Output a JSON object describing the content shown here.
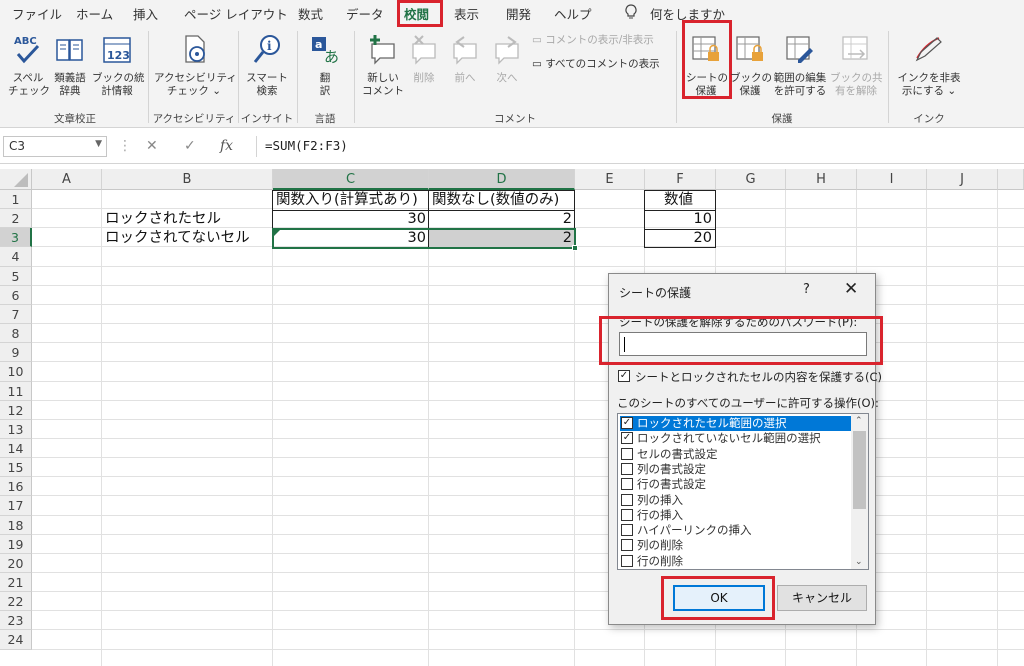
{
  "tabs": [
    "ファイル",
    "ホーム",
    "挿入",
    "ページ レイアウト",
    "数式",
    "データ",
    "校閲",
    "表示",
    "開発",
    "ヘルプ"
  ],
  "tell_me": "何をしますか",
  "ribbon": {
    "buttons": {
      "spelling": [
        "スペル",
        "チェック"
      ],
      "thesaurus": [
        "類義語",
        "辞典"
      ],
      "workbook_stats": [
        "ブックの統",
        "計情報"
      ],
      "accessibility": [
        "アクセシビリティ",
        "チェック ⌄"
      ],
      "smart_lookup": [
        "スマート",
        "検索"
      ],
      "translate": [
        "翻",
        "訳"
      ],
      "new_comment": [
        "新しい",
        "コメント"
      ],
      "delete": "削除",
      "previous": "前へ",
      "next": "次へ",
      "show_hide_comment": "コメントの表示/非表示",
      "show_all_comments": "すべてのコメントの表示",
      "protect_sheet": [
        "シートの",
        "保護"
      ],
      "protect_workbook": [
        "ブックの",
        "保護"
      ],
      "allow_edit_ranges": [
        "範囲の編集",
        "を許可する"
      ],
      "unshare_workbook": [
        "ブックの共",
        "有を解除"
      ],
      "hide_ink": [
        "インクを非表",
        "示にする ⌄"
      ]
    },
    "groups": {
      "proofing": "文章校正",
      "accessibility": "アクセシビリティ",
      "insights": "インサイト",
      "language": "言語",
      "comments": "コメント",
      "protect": "保護",
      "ink": "インク"
    }
  },
  "formula_bar": {
    "name_box": "C3",
    "formula": "=SUM(F2:F3)"
  },
  "grid": {
    "columns": [
      "A",
      "B",
      "C",
      "D",
      "E",
      "F",
      "G",
      "H",
      "I",
      "J"
    ],
    "rows": [
      "1",
      "2",
      "3",
      "4",
      "5",
      "6",
      "7",
      "8",
      "9",
      "10",
      "11",
      "12",
      "13",
      "14",
      "15",
      "16",
      "17",
      "18",
      "19",
      "20",
      "21",
      "22",
      "23",
      "24"
    ],
    "cells": {
      "C1": "関数入り(計算式あり)",
      "D1": "関数なし(数値のみ)",
      "F1": "数値",
      "B2": "ロックされたセル",
      "C2": "30",
      "D2": "2",
      "F2": "10",
      "B3": "ロックされてないセル",
      "C3": "30",
      "D3": "2",
      "F3": "20"
    }
  },
  "dialog": {
    "title": "シートの保護",
    "help": "?",
    "close": "✕",
    "password_label": "シートの保護を解除するためのパスワード(P):",
    "password_value": "",
    "protect_checkbox_label": "シートとロックされたセルの内容を保護する(C)",
    "protect_checked": true,
    "allow_label": "このシートのすべてのユーザーに許可する操作(O):",
    "permissions": [
      {
        "label": "ロックされたセル範囲の選択",
        "checked": true
      },
      {
        "label": "ロックされていないセル範囲の選択",
        "checked": true
      },
      {
        "label": "セルの書式設定",
        "checked": false
      },
      {
        "label": "列の書式設定",
        "checked": false
      },
      {
        "label": "行の書式設定",
        "checked": false
      },
      {
        "label": "列の挿入",
        "checked": false
      },
      {
        "label": "行の挿入",
        "checked": false
      },
      {
        "label": "ハイパーリンクの挿入",
        "checked": false
      },
      {
        "label": "列の削除",
        "checked": false
      },
      {
        "label": "行の削除",
        "checked": false
      }
    ],
    "ok": "OK",
    "cancel": "キャンセル"
  }
}
